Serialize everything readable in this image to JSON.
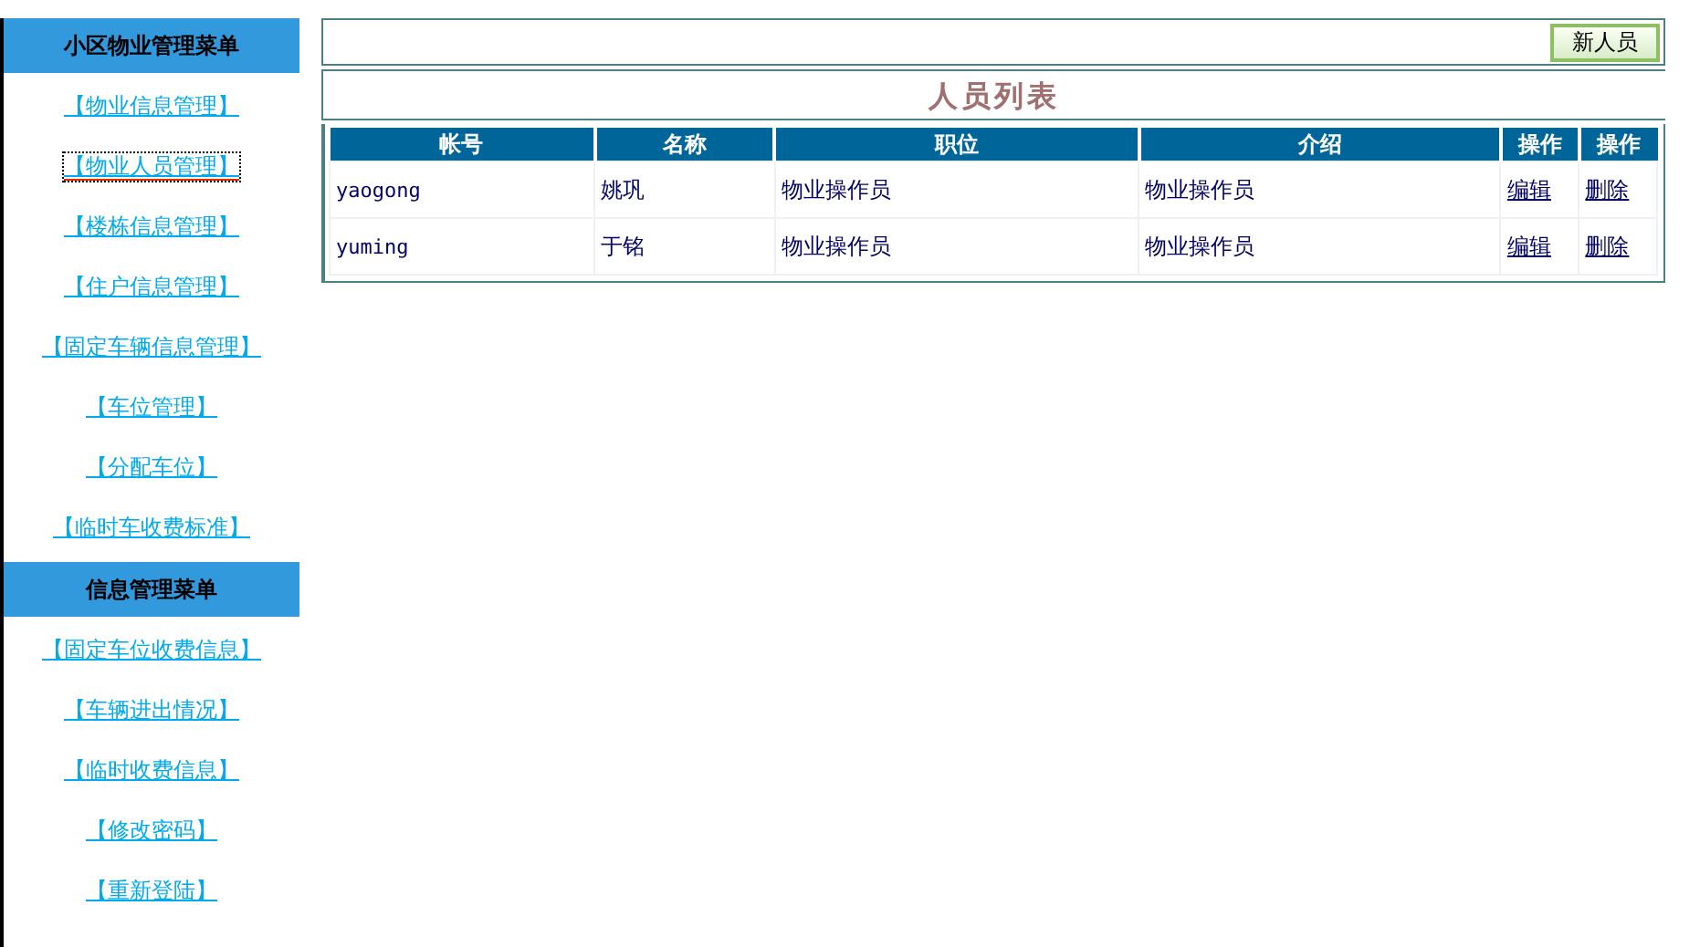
{
  "sidebar": {
    "menus": [
      {
        "title": "小区物业管理菜单",
        "items": [
          {
            "label": "【物业信息管理】",
            "focused": false
          },
          {
            "label": "【物业人员管理】",
            "focused": true
          },
          {
            "label": "【楼栋信息管理】",
            "focused": false
          },
          {
            "label": "【住户信息管理】",
            "focused": false
          },
          {
            "label": "【固定车辆信息管理】",
            "focused": false
          },
          {
            "label": "【车位管理】",
            "focused": false
          },
          {
            "label": "【分配车位】",
            "focused": false
          },
          {
            "label": "【临时车收费标准】",
            "focused": false
          }
        ]
      },
      {
        "title": "信息管理菜单",
        "items": [
          {
            "label": "【固定车位收费信息】",
            "focused": false
          },
          {
            "label": "【车辆进出情况】",
            "focused": false
          },
          {
            "label": "【临时收费信息】",
            "focused": false
          },
          {
            "label": "【修改密码】",
            "focused": false
          },
          {
            "label": "【重新登陆】",
            "focused": false
          }
        ]
      }
    ]
  },
  "toolbar": {
    "button": "新人员"
  },
  "list_title": "人员列表",
  "table": {
    "columns": [
      "帐号",
      "名称",
      "职位",
      "介绍",
      "操作",
      "操作"
    ],
    "rows": [
      {
        "account": "yaogong",
        "name": "姚巩",
        "position": "物业操作员",
        "intro": "物业操作员",
        "edit": "编辑",
        "delete": "删除"
      },
      {
        "account": "yuming",
        "name": "于铭",
        "position": "物业操作员",
        "intro": "物业操作员",
        "edit": "编辑",
        "delete": "删除"
      }
    ]
  }
}
